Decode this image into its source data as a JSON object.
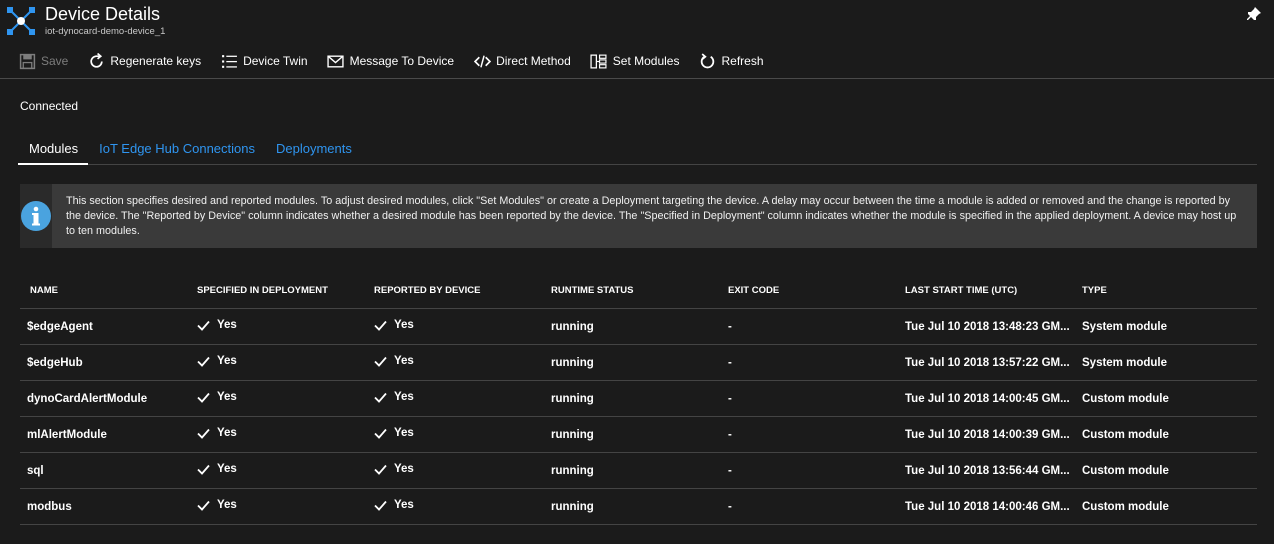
{
  "header": {
    "title": "Device Details",
    "subtitle": "iot-dynocard-demo-device_1",
    "icon": "iot-edge-icon",
    "pin_icon": "pin-icon"
  },
  "toolbar": {
    "save": "Save",
    "regenerate_keys": "Regenerate keys",
    "device_twin": "Device Twin",
    "message_to_device": "Message To Device",
    "direct_method": "Direct Method",
    "set_modules": "Set Modules",
    "refresh": "Refresh"
  },
  "status": "Connected",
  "tabs": [
    {
      "label": "Modules",
      "active": true
    },
    {
      "label": "IoT Edge Hub Connections",
      "active": false
    },
    {
      "label": "Deployments",
      "active": false
    }
  ],
  "info": {
    "text": "This section specifies desired and reported modules.  To adjust desired modules, click \"Set Modules\" or create a Deployment targeting the device.  A delay may occur between the time a module is added or removed and the change is reported by the device.  The \"Reported by Device\" column indicates whether a desired module has been reported by the device.  The \"Specified in Deployment\" column indicates whether the module is specified in the applied deployment.  A device may host up to ten modules."
  },
  "table": {
    "columns": [
      "NAME",
      "SPECIFIED IN DEPLOYMENT",
      "REPORTED BY DEVICE",
      "RUNTIME STATUS",
      "EXIT CODE",
      "LAST START TIME (UTC)",
      "TYPE"
    ],
    "rows": [
      {
        "name": "$edgeAgent",
        "specified": "Yes",
        "reported": "Yes",
        "runtime": "running",
        "exit": "-",
        "start": "Tue Jul 10 2018 13:48:23 GM...",
        "type": "System module"
      },
      {
        "name": "$edgeHub",
        "specified": "Yes",
        "reported": "Yes",
        "runtime": "running",
        "exit": "-",
        "start": "Tue Jul 10 2018 13:57:22 GM...",
        "type": "System module"
      },
      {
        "name": "dynoCardAlertModule",
        "specified": "Yes",
        "reported": "Yes",
        "runtime": "running",
        "exit": "-",
        "start": "Tue Jul 10 2018 14:00:45 GM...",
        "type": "Custom module"
      },
      {
        "name": "mlAlertModule",
        "specified": "Yes",
        "reported": "Yes",
        "runtime": "running",
        "exit": "-",
        "start": "Tue Jul 10 2018 14:00:39 GM...",
        "type": "Custom module"
      },
      {
        "name": "sql",
        "specified": "Yes",
        "reported": "Yes",
        "runtime": "running",
        "exit": "-",
        "start": "Tue Jul 10 2018 13:56:44 GM...",
        "type": "Custom module"
      },
      {
        "name": "modbus",
        "specified": "Yes",
        "reported": "Yes",
        "runtime": "running",
        "exit": "-",
        "start": "Tue Jul 10 2018 14:00:46 GM...",
        "type": "Custom module"
      }
    ]
  },
  "colors": {
    "background": "#1b1b1b",
    "accent": "#2f95f0",
    "info_background": "#3a3a3a",
    "info_icon": "#4aa3df"
  }
}
